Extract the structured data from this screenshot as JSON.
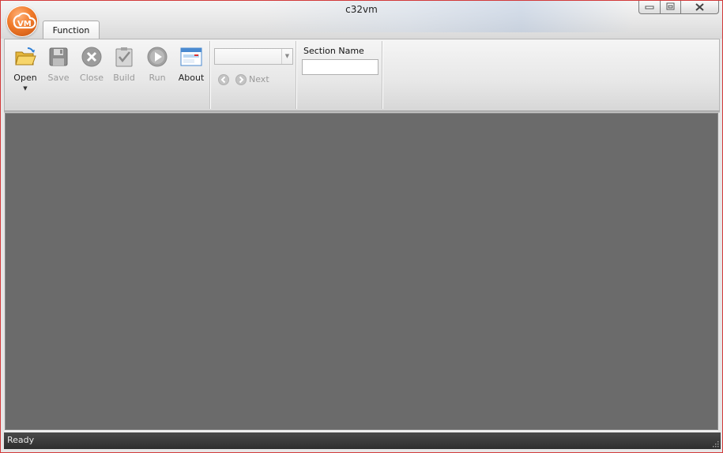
{
  "window": {
    "title": "c32vm",
    "app_logo_text": "VM",
    "controls": {
      "minimize": "minimize",
      "maximize": "maximize",
      "close": "close"
    }
  },
  "tabs": [
    {
      "label": "Function",
      "active": true
    }
  ],
  "ribbon": {
    "buttons": [
      {
        "label": "Open",
        "icon": "folder-open-icon",
        "enabled": true,
        "has_dropdown": true
      },
      {
        "label": "Save",
        "icon": "floppy-disk-icon",
        "enabled": false
      },
      {
        "label": "Close",
        "icon": "close-circle-icon",
        "enabled": false
      },
      {
        "label": "Build",
        "icon": "clipboard-check-icon",
        "enabled": false
      },
      {
        "label": "Run",
        "icon": "play-icon",
        "enabled": false
      },
      {
        "label": "About",
        "icon": "window-info-icon",
        "enabled": true
      }
    ],
    "navigation": {
      "combo_value": "",
      "next_label": "Next",
      "prev_enabled": false,
      "next_enabled": false
    },
    "section": {
      "label": "Section Name",
      "value": ""
    }
  },
  "status": {
    "text": "Ready"
  },
  "colors": {
    "workspace": "#6b6b6b",
    "statusbar": "#3a3a3a",
    "orb": "#f07a2a",
    "window_border": "#d23a3a"
  }
}
